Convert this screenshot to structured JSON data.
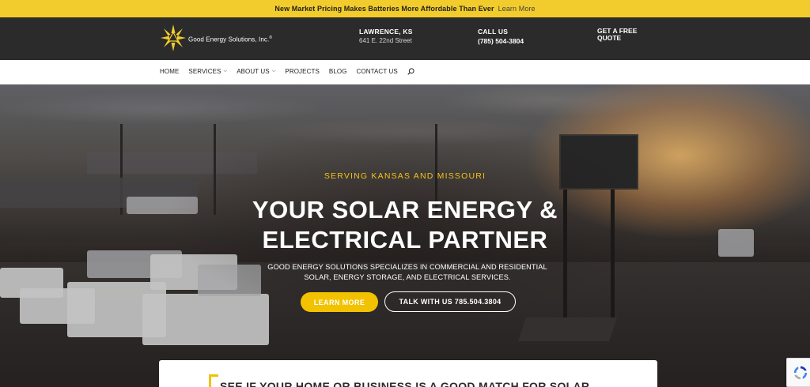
{
  "announcement": {
    "message": "New Market Pricing Makes Batteries More Affordable Than Ever",
    "link": "Learn More"
  },
  "brand": {
    "name": "Good Energy Solutions, Inc.",
    "registered": "®",
    "accent": "#f2c200",
    "dark": "#2b2b2b"
  },
  "header": {
    "location_title": "LAWRENCE, KS",
    "location_address": "641 E. 22nd Street",
    "call_title": "CALL US",
    "call_number": "(785) 504-3804",
    "quote_line1": "GET A FREE",
    "quote_line2": "QUOTE"
  },
  "nav": {
    "items": [
      {
        "label": "HOME",
        "dropdown": false
      },
      {
        "label": "SERVICES",
        "dropdown": true
      },
      {
        "label": "ABOUT US",
        "dropdown": true
      },
      {
        "label": "PROJECTS",
        "dropdown": false
      },
      {
        "label": "BLOG",
        "dropdown": false
      },
      {
        "label": "CONTACT US",
        "dropdown": false
      }
    ],
    "search_icon": "search-icon"
  },
  "hero": {
    "eyebrow": "SERVING KANSAS AND MISSOURI",
    "headline_line1": "YOUR SOLAR ENERGY &",
    "headline_line2": "ELECTRICAL PARTNER",
    "subtext": "GOOD ENERGY SOLUTIONS SPECIALIZES IN COMMERCIAL AND RESIDENTIAL SOLAR, ENERGY STORAGE, AND ELECTRICAL SERVICES.",
    "primary_button": "LEARN MORE",
    "secondary_button": "TALK WITH US 785.504.3804"
  },
  "card": {
    "title": "SEE IF YOUR HOME OR BUSINESS IS A GOOD MATCH FOR SOLAR"
  }
}
